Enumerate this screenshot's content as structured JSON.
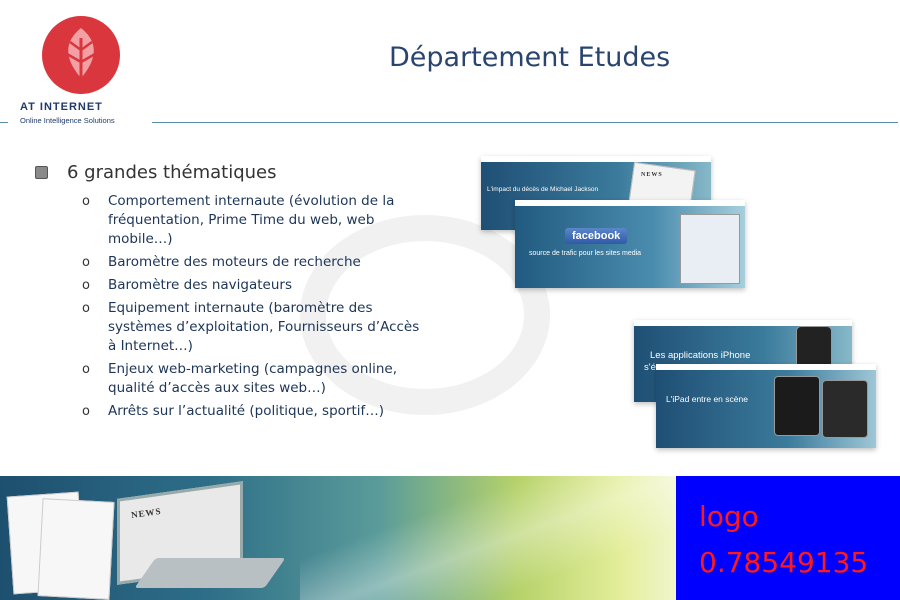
{
  "header": {
    "logo_name": "AT INTERNET",
    "logo_tagline": "Online Intelligence Solutions",
    "title": "Département Etudes"
  },
  "content": {
    "main_bullet": "6 grandes thématiques",
    "sub_bullet_glyph": "o",
    "sub_items": [
      {
        "lines": [
          "Comportement internaute (évolution de la",
          "fréquentation, Prime Time du web, web",
          "mobile…)"
        ]
      },
      {
        "lines": [
          "Baromètre des moteurs de recherche"
        ]
      },
      {
        "lines": [
          "Baromètre des navigateurs"
        ]
      },
      {
        "lines": [
          "Equipement internaute (baromètre des",
          "systèmes d’exploitation, Fournisseurs d’Accès",
          "à Internet…)"
        ]
      },
      {
        "lines": [
          "Enjeux web-marketing (campagnes online,",
          "qualité d’accès aux sites web…)"
        ]
      },
      {
        "lines": [
          "Arrêts sur l’actualité (politique, sportif…)"
        ]
      }
    ]
  },
  "thumbnails": {
    "t1_caption": "L'impact du décès de Michael Jackson",
    "t1_news": "NEWS",
    "t2_badge": "facebook",
    "t2_caption": "source de trafic pour les sites media",
    "t3_caption": "Les applications iPhone",
    "t3_caption_cut": "s'é",
    "t4_caption": "L'iPad entre en scène"
  },
  "banner": {
    "news_label": "NEWS"
  },
  "overlay": {
    "label": "logo",
    "score": "0.78549135"
  },
  "colors": {
    "logo_red": "#d9363e",
    "title_blue": "#2a4470",
    "overlay_blue": "#0000ff",
    "overlay_text": "#ff1a1a"
  }
}
